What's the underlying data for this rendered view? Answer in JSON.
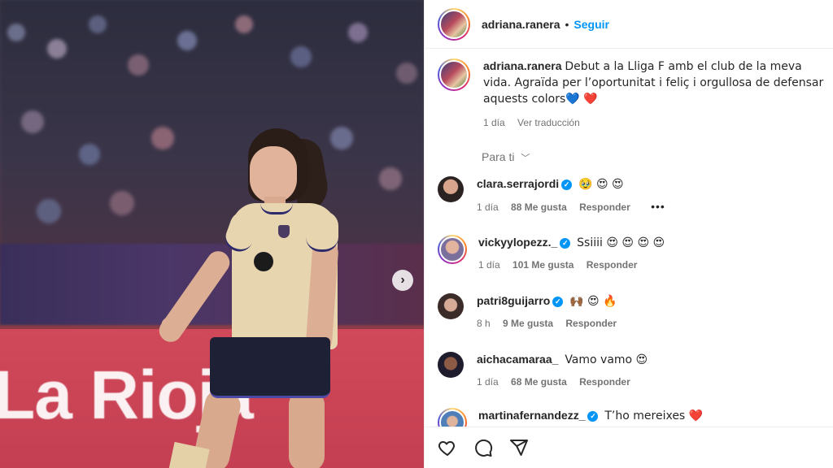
{
  "post": {
    "author": "adriana.ranera",
    "follow_label": "Seguir",
    "caption": "Debut a la Lliga F amb el club de la meva vida. Agraïda per l’oportunitat i feliç i orgullosa de defensar aquests colors💙 ❤️",
    "time": "1 día",
    "translate_label": "Ver traducción",
    "banner_text": "La Rioja"
  },
  "sort_label": "Para ti",
  "comments": [
    {
      "user": "clara.serrajordi",
      "verified": true,
      "text": "🥹 😍 😍",
      "time": "1 día",
      "likes": "88 Me gusta",
      "reply": "Responder",
      "more": "•••"
    },
    {
      "user": "vickyylopezz._",
      "verified": true,
      "text": "Ssiiii 😍 😍 😍 😍",
      "time": "1 día",
      "likes": "101 Me gusta",
      "reply": "Responder"
    },
    {
      "user": "patri8guijarro",
      "verified": true,
      "text": "🙌🏾 😍 🔥",
      "time": "8 h",
      "likes": "9 Me gusta",
      "reply": "Responder"
    },
    {
      "user": "aichacamaraa_",
      "verified": false,
      "text": "Vamo vamo 😍",
      "time": "1 día",
      "likes": "68 Me gusta",
      "reply": "Responder"
    },
    {
      "user": "martinafernandezz_",
      "verified": true,
      "text": "T’ho mereixes ❤️"
    }
  ],
  "icons": {
    "like": "heart-icon",
    "comment": "comment-icon",
    "share": "share-icon",
    "next": "chevron-right-icon",
    "verified": "verified-badge-icon"
  },
  "colors": {
    "accent": "#0095f6",
    "text": "#262626",
    "muted": "#737373"
  }
}
